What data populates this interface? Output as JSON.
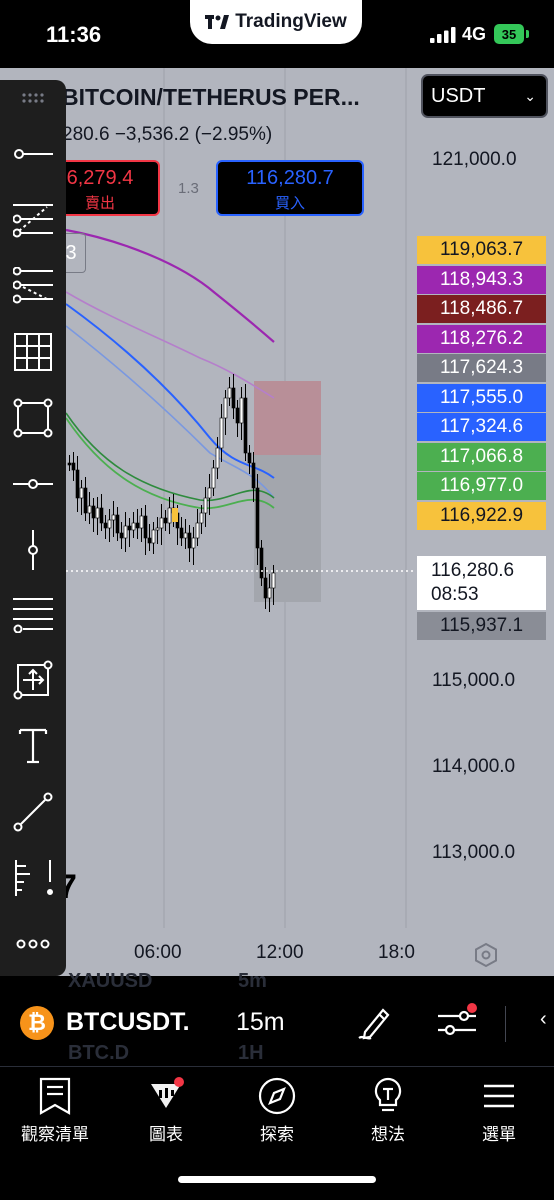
{
  "status_bar": {
    "time": "11:36",
    "network": "4G",
    "battery": "35"
  },
  "brand": {
    "name": "TradingView"
  },
  "header": {
    "symbol_title": "BITCOIN/TETHERUS PER...",
    "change_line": "280.6  −3,536.2 (−2.95%)",
    "sell_price": "6,279.4",
    "sell_label": "賣出",
    "buy_price": "116,280.7",
    "buy_label": "買入",
    "spread": "1.3",
    "mini_button": "3",
    "currency": "USDT"
  },
  "axis": {
    "price_labels": [
      "121,000.0",
      "115,000.0",
      "114,000.0",
      "113,000.0"
    ],
    "time_labels": [
      "06:00",
      "12:00",
      "18:0"
    ],
    "partial_label": "7"
  },
  "price_tags": [
    {
      "value": "119,063.7",
      "color": "#f7c23c",
      "text_color": "#131722"
    },
    {
      "value": "118,943.3",
      "color": "#9c27b0",
      "text_color": "#ffffff"
    },
    {
      "value": "118,486.7",
      "color": "#7b1f1f",
      "text_color": "#ffffff"
    },
    {
      "value": "118,276.2",
      "color": "#9c27b0",
      "text_color": "#ffffff"
    },
    {
      "value": "117,624.3",
      "color": "#787b86",
      "text_color": "#ffffff"
    },
    {
      "value": "117,555.0",
      "color": "#2962ff",
      "text_color": "#ffffff"
    },
    {
      "value": "117,324.6",
      "color": "#2962ff",
      "text_color": "#ffffff"
    },
    {
      "value": "117,066.8",
      "color": "#4caf50",
      "text_color": "#ffffff"
    },
    {
      "value": "116,977.0",
      "color": "#4caf50",
      "text_color": "#ffffff"
    },
    {
      "value": "116,922.9",
      "color": "#f7c23c",
      "text_color": "#131722"
    }
  ],
  "last_price": {
    "value": "116,280.6",
    "countdown": "08:53"
  },
  "low_tag": {
    "value": "115,937.1",
    "color": "#8a8d96"
  },
  "toolbar": {
    "tools": [
      "drag-handle",
      "horizontal-line",
      "fib-retracement",
      "pitchfork",
      "grid",
      "rectangle",
      "horizontal-ray",
      "vertical-line",
      "parallel-lines",
      "measure",
      "text",
      "trend-line",
      "long-short-position",
      "more"
    ]
  },
  "bottom_bar": {
    "symbol": "BTCUSDT.",
    "interval": "15m",
    "ghost_top": {
      "symbol": "XAUUSD",
      "interval": "5m"
    },
    "ghost_bottom": {
      "symbol": "BTC.D",
      "interval": "1H"
    }
  },
  "nav": [
    {
      "label": "觀察清單",
      "icon": "watchlist-icon"
    },
    {
      "label": "圖表",
      "icon": "chart-icon"
    },
    {
      "label": "探索",
      "icon": "compass-icon"
    },
    {
      "label": "想法",
      "icon": "ideas-icon"
    },
    {
      "label": "選單",
      "icon": "menu-icon"
    }
  ],
  "colors": {
    "accent": "#2962ff",
    "sell": "#f23645",
    "chart_bg": "#b2b5be",
    "toolbar_bg": "#1e1e1e"
  }
}
